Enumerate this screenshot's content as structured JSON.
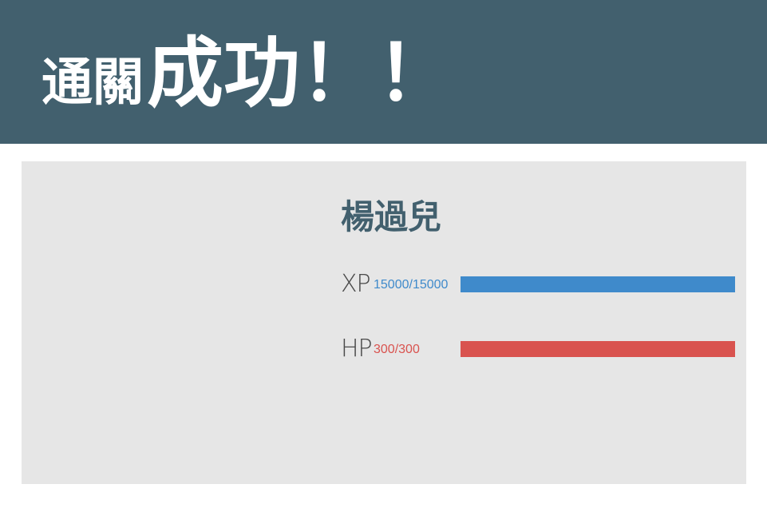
{
  "banner": {
    "title_prefix": "通關",
    "title_main": "成功！！"
  },
  "player": {
    "name": "楊過兒",
    "stats": {
      "xp": {
        "label": "XP",
        "value": "15000/15000",
        "current": 15000,
        "max": 15000,
        "color": "#3f8acb"
      },
      "hp": {
        "label": "HP",
        "value": "300/300",
        "current": 300,
        "max": 300,
        "color": "#d9534f"
      }
    }
  },
  "colors": {
    "banner_bg": "#42606e",
    "card_bg": "#e6e6e6"
  }
}
